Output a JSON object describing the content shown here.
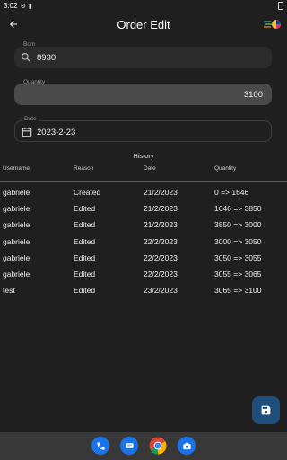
{
  "status_bar": {
    "time": "3:02"
  },
  "app_bar": {
    "title": "Order Edit"
  },
  "form": {
    "bom": {
      "label": "Bom",
      "value": "8930"
    },
    "quantity": {
      "label": "Quantity",
      "value": "3100"
    },
    "date": {
      "label": "Date",
      "value": "2023-2-23"
    }
  },
  "history": {
    "title": "History",
    "columns": [
      "Username",
      "Reason",
      "Date",
      "Quantity"
    ],
    "rows": [
      [
        "gabriele",
        "Created",
        "21/2/2023",
        "0 => 1646"
      ],
      [
        "gabriele",
        "Edited",
        "21/2/2023",
        "1646 => 3850"
      ],
      [
        "gabriele",
        "Edited",
        "21/2/2023",
        "3850 => 3000"
      ],
      [
        "gabriele",
        "Edited",
        "22/2/2023",
        "3000 => 3050"
      ],
      [
        "gabriele",
        "Edited",
        "22/2/2023",
        "3050 => 3055"
      ],
      [
        "gabriele",
        "Edited",
        "22/2/2023",
        "3055 => 3065"
      ],
      [
        "test",
        "Edited",
        "23/2/2023",
        "3065 => 3100"
      ]
    ]
  },
  "icons": {
    "back": "arrow-left-icon",
    "bom_field": "search-icon",
    "date_field": "calendar-icon",
    "save": "save-icon",
    "nav": [
      "phone-icon",
      "messages-icon",
      "chrome-icon",
      "camera-icon"
    ]
  },
  "colors": {
    "background": "#1f1f1f",
    "fab": "#1e4f7c",
    "nav_bar": "#383838"
  }
}
